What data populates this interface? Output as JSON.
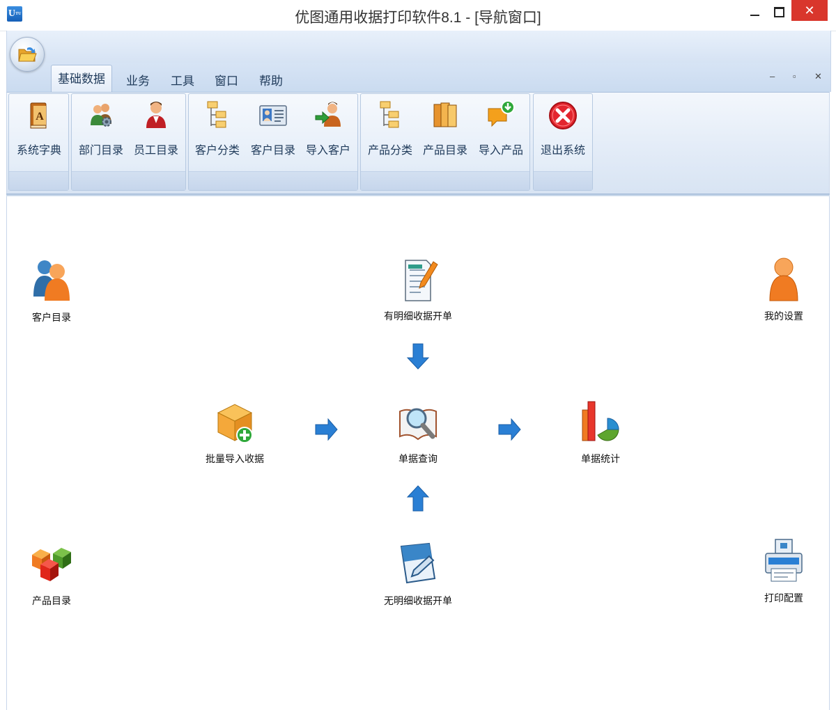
{
  "window": {
    "title": "优图通用收据打印软件8.1 - [导航窗口]",
    "logo_text": "U",
    "logo_sub": "TU",
    "close_glyph": "✕"
  },
  "ribbon": {
    "tabs": [
      {
        "label": "基础数据",
        "active": true
      },
      {
        "label": "业务",
        "active": false
      },
      {
        "label": "工具",
        "active": false
      },
      {
        "label": "窗口",
        "active": false
      },
      {
        "label": "帮助",
        "active": false
      }
    ],
    "mdi_controls": {
      "minimize": "–",
      "restore": "▫",
      "close": "✕"
    },
    "buttons": [
      {
        "label": "系统字典",
        "icon": "dictionary-book-icon"
      },
      {
        "label": "部门目录",
        "icon": "department-users-icon"
      },
      {
        "label": "员工目录",
        "icon": "employee-icon"
      },
      {
        "label": "客户分类",
        "icon": "customer-category-tree-icon"
      },
      {
        "label": "客户目录",
        "icon": "customer-card-icon"
      },
      {
        "label": "导入客户",
        "icon": "import-customer-icon"
      },
      {
        "label": "产品分类",
        "icon": "product-category-tree-icon"
      },
      {
        "label": "产品目录",
        "icon": "product-books-icon"
      },
      {
        "label": "导入产品",
        "icon": "import-product-icon"
      },
      {
        "label": "退出系统",
        "icon": "exit-icon"
      }
    ]
  },
  "navigation": {
    "items": [
      {
        "id": "customer-directory",
        "label": "客户目录",
        "icon": "customers-icon"
      },
      {
        "id": "detailed-receipt",
        "label": "有明细收据开单",
        "icon": "detailed-receipt-icon"
      },
      {
        "id": "my-settings",
        "label": "我的设置",
        "icon": "user-settings-icon"
      },
      {
        "id": "batch-import",
        "label": "批量导入收据",
        "icon": "batch-import-box-icon"
      },
      {
        "id": "receipt-query",
        "label": "单据查询",
        "icon": "receipt-query-magnifier-icon"
      },
      {
        "id": "receipt-stats",
        "label": "单据统计",
        "icon": "receipt-statistics-chart-icon"
      },
      {
        "id": "product-directory",
        "label": "产品目录",
        "icon": "product-cubes-icon"
      },
      {
        "id": "simple-receipt",
        "label": "无明细收据开单",
        "icon": "simple-receipt-icon"
      },
      {
        "id": "print-config",
        "label": "打印配置",
        "icon": "printer-icon"
      }
    ],
    "arrows": [
      "arrow-down-icon",
      "arrow-right-icon",
      "arrow-right-icon",
      "arrow-up-icon"
    ]
  },
  "colors": {
    "ribbon_blue": "#dbe6f3",
    "close_red": "#d9362c",
    "arrow_blue": "#2a7fd4"
  }
}
